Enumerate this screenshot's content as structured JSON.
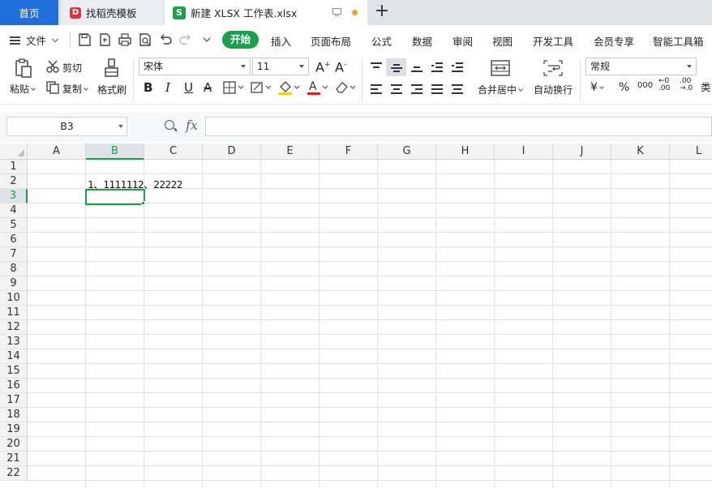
{
  "tabs": {
    "home": "首页",
    "template": "找稻壳模板",
    "document": "新建 XLSX 工作表.xlsx",
    "add": "+"
  },
  "menu": {
    "file": "文件",
    "start": "开始",
    "items": [
      "插入",
      "页面布局",
      "公式",
      "数据",
      "审阅",
      "视图",
      "开发工具",
      "会员专享",
      "智能工具箱"
    ]
  },
  "ribbon": {
    "paste": "粘贴",
    "cut": "剪切",
    "copy": "复制",
    "format_painter": "格式刷",
    "font_name": "宋体",
    "font_size": "11",
    "merge_center": "合并居中",
    "wrap_text": "自动换行",
    "number_format": "常规",
    "currency_symbol": "¥",
    "percent_symbol": "%",
    "thousands": "000",
    "type_label": "类"
  },
  "formula_bar": {
    "name_box": "B3",
    "fx": "fx",
    "formula": ""
  },
  "sheet": {
    "columns": [
      "A",
      "B",
      "C",
      "D",
      "E",
      "F",
      "G",
      "H",
      "I",
      "J",
      "K",
      "L"
    ],
    "rows": [
      "1",
      "2",
      "3",
      "4",
      "5",
      "6",
      "7",
      "8",
      "9",
      "10",
      "11",
      "12",
      "13",
      "14",
      "15",
      "16",
      "17",
      "18",
      "19",
      "20",
      "21",
      "22"
    ],
    "selected_column": "B",
    "selected_row": "3",
    "cell_B2": "1、1111112、22222"
  },
  "colors": {
    "accent_green": "#1aa14e",
    "home_tab_blue": "#1e6fd9"
  }
}
